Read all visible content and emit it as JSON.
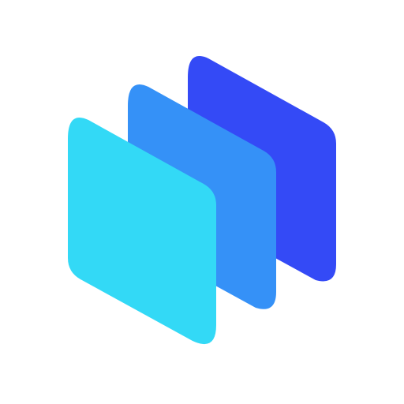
{
  "logo": {
    "layers": [
      {
        "name": "back-layer",
        "color": "#344AF6"
      },
      {
        "name": "middle-layer",
        "color": "#3591F7"
      },
      {
        "name": "front-layer",
        "color": "#33D9F6"
      }
    ]
  },
  "background_color": "#FFFFFF"
}
